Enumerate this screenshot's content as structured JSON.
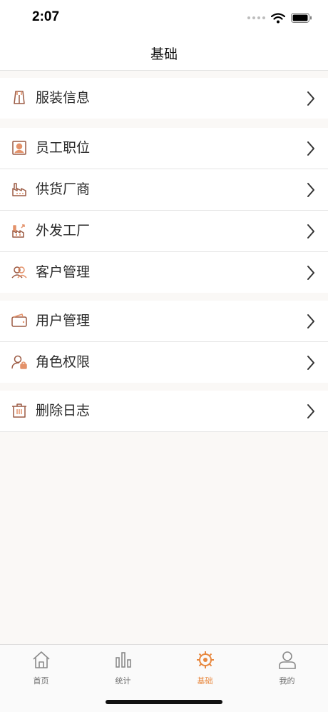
{
  "status_bar": {
    "time": "2:07"
  },
  "nav": {
    "title": "基础"
  },
  "sections": [
    {
      "items": [
        {
          "label": "服装信息",
          "icon": "clothing-icon"
        }
      ]
    },
    {
      "items": [
        {
          "label": "员工职位",
          "icon": "employee-badge-icon"
        },
        {
          "label": "供货厂商",
          "icon": "supplier-factory-icon"
        },
        {
          "label": "外发工厂",
          "icon": "outsource-factory-icon"
        },
        {
          "label": "客户管理",
          "icon": "customers-icon"
        }
      ]
    },
    {
      "items": [
        {
          "label": "用户管理",
          "icon": "wallet-icon"
        },
        {
          "label": "角色权限",
          "icon": "user-lock-icon"
        }
      ]
    },
    {
      "items": [
        {
          "label": "删除日志",
          "icon": "trash-icon"
        }
      ]
    }
  ],
  "tabs": [
    {
      "label": "首页",
      "icon": "home-icon",
      "active": false
    },
    {
      "label": "统计",
      "icon": "bar-chart-icon",
      "active": false
    },
    {
      "label": "基础",
      "icon": "gear-icon",
      "active": true
    },
    {
      "label": "我的",
      "icon": "person-icon",
      "active": false
    }
  ],
  "colors": {
    "accent": "#e8883f",
    "icon_brown": "#9b5a43",
    "icon_accent": "#e4926a",
    "background": "#faf8f6"
  }
}
